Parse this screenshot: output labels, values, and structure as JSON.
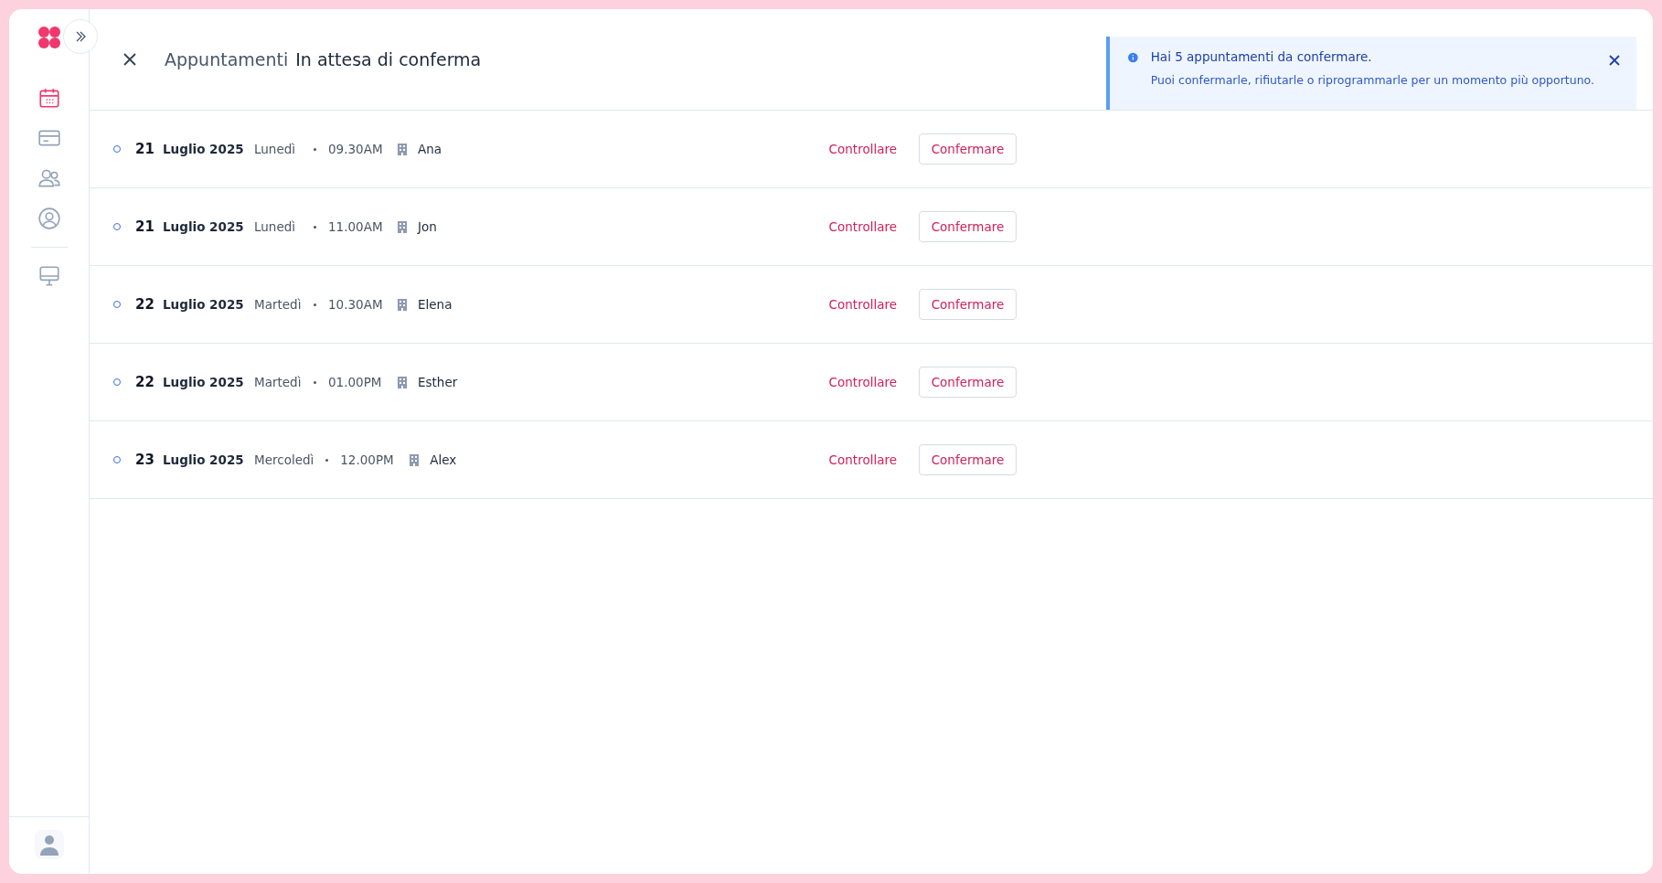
{
  "sidebar": {
    "items": [
      {
        "kind": "calendar",
        "selected": true
      },
      {
        "kind": "card",
        "selected": false
      },
      {
        "kind": "people",
        "selected": false
      },
      {
        "kind": "user",
        "selected": false
      },
      {
        "kind": "monitor",
        "selected": false
      }
    ]
  },
  "header": {
    "section": "Appuntamenti",
    "title": "In attesa di conferma"
  },
  "notice": {
    "title": "Hai 5 appuntamenti da confermare.",
    "message": "Puoi confermarle, rifiutarle o riprogrammarle per un momento più opportuno."
  },
  "appointments": [
    {
      "day": "21",
      "month": "Luglio 2025",
      "weekday": "Lunedì",
      "time": "09.30AM",
      "name": "Ana",
      "review": "Controllare",
      "confirm": "Confermare"
    },
    {
      "day": "21",
      "month": "Luglio 2025",
      "weekday": "Lunedì",
      "time": "11.00AM",
      "name": "Jon",
      "review": "Controllare",
      "confirm": "Confermare"
    },
    {
      "day": "22",
      "month": "Luglio 2025",
      "weekday": "Martedì",
      "time": "10.30AM",
      "name": "Elena",
      "review": "Controllare",
      "confirm": "Confermare"
    },
    {
      "day": "22",
      "month": "Luglio 2025",
      "weekday": "Martedì",
      "time": "01.00PM",
      "name": "Esther",
      "review": "Controllare",
      "confirm": "Confermare"
    },
    {
      "day": "23",
      "month": "Luglio 2025",
      "weekday": "Mercoledì",
      "time": "12.00PM",
      "name": "Alex",
      "review": "Controllare",
      "confirm": "Confermare"
    }
  ]
}
